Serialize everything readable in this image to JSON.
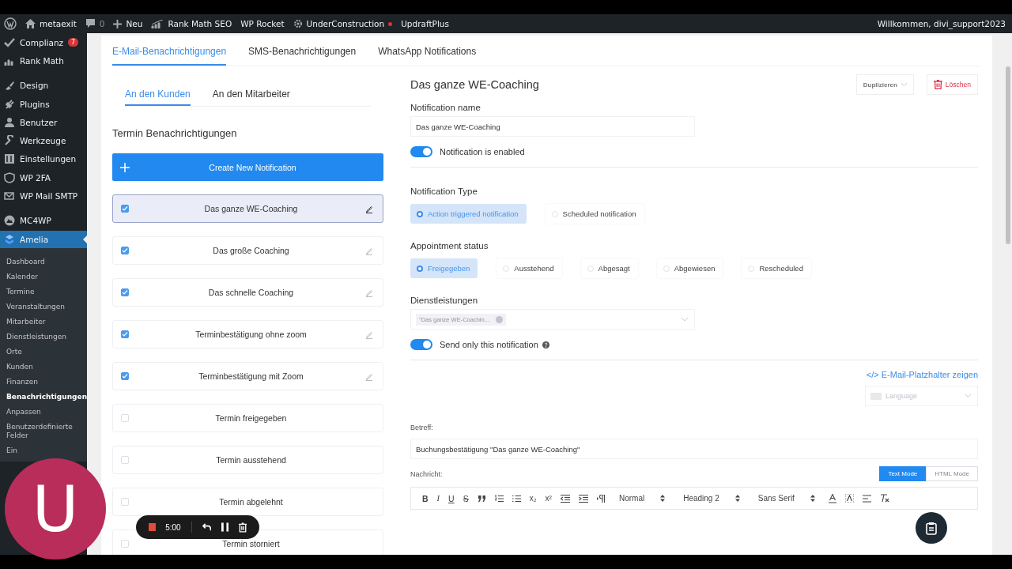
{
  "admin_bar": {
    "items": [
      {
        "kind": "wp-logo"
      },
      {
        "kind": "home",
        "label": "metaexit"
      },
      {
        "kind": "comments",
        "label": "0"
      },
      {
        "kind": "new",
        "label": "Neu"
      },
      {
        "kind": "seo",
        "label": "Rank Math SEO"
      },
      {
        "kind": "plain",
        "label": "WP Rocket"
      },
      {
        "kind": "gear",
        "label": "UnderConstruction",
        "alert": true
      },
      {
        "kind": "plain",
        "label": "UpdraftPlus"
      }
    ],
    "greeting": "Willkommen, divi_support2023"
  },
  "sidebar": {
    "groups": [
      {
        "items": [
          {
            "label": "Complianz",
            "kind": "check",
            "badge": "7",
            "selected": false
          },
          {
            "label": "Rank Math",
            "kind": "chart",
            "selected": false
          }
        ]
      },
      {
        "items": [
          {
            "label": "Design",
            "kind": "brush",
            "selected": false
          },
          {
            "label": "Plugins",
            "kind": "plug",
            "selected": false
          },
          {
            "label": "Benutzer",
            "kind": "user",
            "selected": false
          },
          {
            "label": "Werkzeuge",
            "kind": "wrench",
            "selected": false
          },
          {
            "label": "Einstellungen",
            "kind": "sliders",
            "selected": false
          },
          {
            "label": "WP 2FA",
            "kind": "shield",
            "selected": false
          },
          {
            "label": "WP Mail SMTP",
            "kind": "mail",
            "selected": false
          }
        ]
      },
      {
        "items": [
          {
            "label": "MC4WP",
            "kind": "mountain",
            "selected": false
          },
          {
            "label": "Amelia",
            "kind": "amelia",
            "selected": true
          }
        ]
      }
    ],
    "submenu": [
      {
        "label": "Dashboard",
        "selected": false
      },
      {
        "label": "Kalender",
        "selected": false
      },
      {
        "label": "Termine",
        "selected": false
      },
      {
        "label": "Veranstaltungen",
        "selected": false
      },
      {
        "label": "Mitarbeiter",
        "selected": false
      },
      {
        "label": "Dienstleistungen",
        "selected": false
      },
      {
        "label": "Orte",
        "selected": false
      },
      {
        "label": "Kunden",
        "selected": false
      },
      {
        "label": "Finanzen",
        "selected": false
      },
      {
        "label": "Benachrichtigungen",
        "selected": true
      },
      {
        "label": "Anpassen",
        "selected": false
      },
      {
        "label": "Benutzerdefinierte Felder",
        "selected": false
      },
      {
        "label": "Ein",
        "selected": false
      }
    ]
  },
  "tabs": [
    {
      "label": "E-Mail-Benachrichtigungen",
      "selected": true
    },
    {
      "label": "SMS-Benachrichtigungen",
      "selected": false
    },
    {
      "label": "WhatsApp Notifications",
      "selected": false
    }
  ],
  "subtabs": [
    {
      "label": "An den Kunden",
      "selected": true
    },
    {
      "label": "An den Mitarbeiter",
      "selected": false
    }
  ],
  "list": {
    "heading": "Termin Benachrichtigungen",
    "create_button": "Create New Notification",
    "items": [
      {
        "label": "Das ganze WE-Coaching",
        "checked": true,
        "selected": true
      },
      {
        "label": "Das große Coaching",
        "checked": true,
        "selected": false
      },
      {
        "label": "Das schnelle Coaching",
        "checked": true,
        "selected": false
      },
      {
        "label": "Terminbestätigung ohne zoom",
        "checked": true,
        "selected": false
      },
      {
        "label": "Terminbestätigung mit Zoom",
        "checked": true,
        "selected": false
      },
      {
        "label": "Termin freigegeben",
        "checked": false,
        "selected": false
      },
      {
        "label": "Termin ausstehend",
        "checked": false,
        "selected": false
      },
      {
        "label": "Termin abgelehnt",
        "checked": false,
        "selected": false
      },
      {
        "label": "Termin storniert",
        "checked": false,
        "selected": false
      }
    ]
  },
  "details": {
    "title": "Das ganze WE-Coaching",
    "duplicate_button": "Duplizieren",
    "delete_button": "Löschen",
    "name_label": "Notification name",
    "name_value": "Das ganze WE-Coaching",
    "enabled": {
      "label": "Notification is enabled",
      "on": true
    },
    "type_label": "Notification Type",
    "types": [
      {
        "label": "Action triggered notification",
        "selected": true
      },
      {
        "label": "Scheduled notification",
        "selected": false
      }
    ],
    "status_label": "Appointment status",
    "statuses": [
      {
        "label": "Freigegeben",
        "selected": true
      },
      {
        "label": "Ausstehend",
        "selected": false
      },
      {
        "label": "Abgesagt",
        "selected": false
      },
      {
        "label": "Abgewiesen",
        "selected": false
      },
      {
        "label": "Rescheduled",
        "selected": false
      }
    ],
    "services_label": "Dienstleistungen",
    "services": [
      "\"Das ganze WE-Coachin..."
    ],
    "send_only": {
      "label": "Send only this notification",
      "on": true
    },
    "placeholders_link": "</> E-Mail-Platzhalter zeigen",
    "language_placeholder": "Language",
    "subject_label": "Betreff:",
    "subject_value": "Buchungsbestätigung \"Das ganze WE-Coaching\"",
    "message_label": "Nachricht:",
    "modes": [
      {
        "label": "Text Mode",
        "selected": true
      },
      {
        "label": "HTML Mode",
        "selected": false
      }
    ],
    "toolbar": {
      "marks": [
        "B",
        "I",
        "U",
        "S"
      ],
      "scripts": [
        "x₂",
        "x²"
      ],
      "selects": [
        "Normal",
        "Heading 2",
        "Sans Serif"
      ]
    }
  },
  "recorder": {
    "time": "5:00"
  },
  "avatar": {
    "initial": "U"
  }
}
